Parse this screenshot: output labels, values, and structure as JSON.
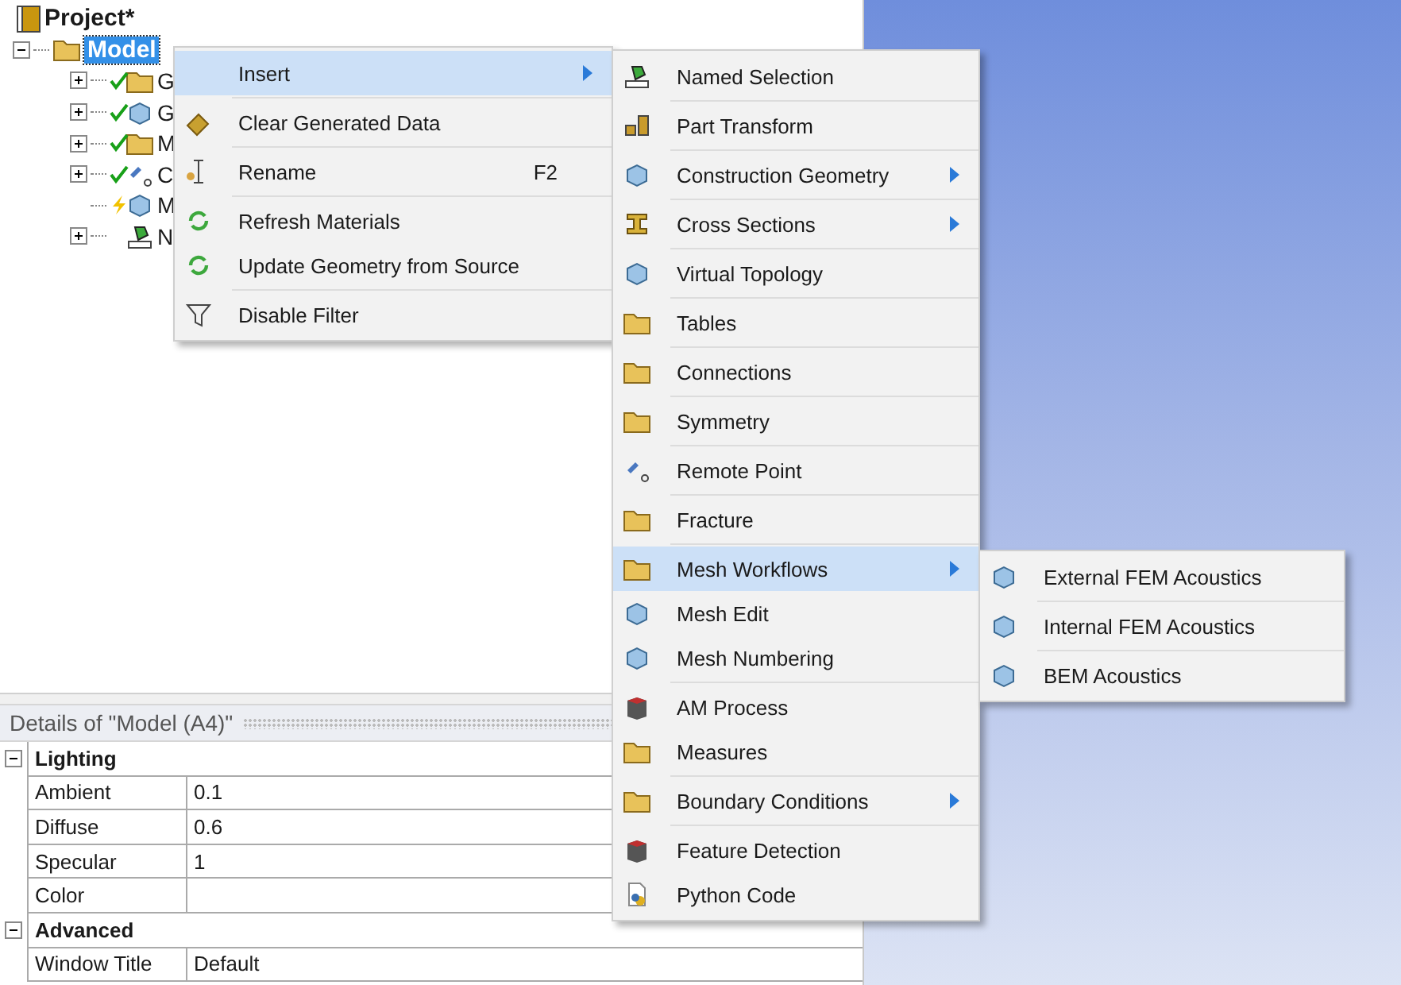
{
  "tree": {
    "root": {
      "label": "Project*"
    },
    "model": {
      "label": "Model",
      "selected": true,
      "expanded": true,
      "children": [
        {
          "label": "G",
          "ok": true,
          "stale": false,
          "expandable": true
        },
        {
          "label": "G",
          "ok": true,
          "stale": false,
          "expandable": true
        },
        {
          "label": "M",
          "ok": true,
          "stale": false,
          "expandable": true
        },
        {
          "label": "C",
          "ok": true,
          "stale": false,
          "expandable": true
        },
        {
          "label": "M",
          "ok": false,
          "stale": true,
          "expandable": false
        },
        {
          "label": "N",
          "ok": false,
          "stale": false,
          "expandable": true
        }
      ]
    }
  },
  "context_menu": {
    "items": [
      {
        "label": "Insert",
        "submenu": true,
        "selected": true,
        "divider_below": true
      },
      {
        "label": "Clear Generated Data",
        "submenu": false,
        "selected": false,
        "divider_below": true
      },
      {
        "label": "Rename",
        "shortcut": "F2",
        "submenu": false,
        "selected": false,
        "divider_below": true
      },
      {
        "label": "Refresh Materials",
        "submenu": false,
        "selected": false,
        "divider_below": false
      },
      {
        "label": "Update Geometry from Source",
        "submenu": false,
        "selected": false,
        "divider_below": true
      },
      {
        "label": "Disable Filter",
        "submenu": false,
        "selected": false,
        "divider_below": false
      }
    ]
  },
  "insert_menu": {
    "items": [
      {
        "label": "Named Selection",
        "submenu": false,
        "selected": false,
        "divider_below": true
      },
      {
        "label": "Part Transform",
        "submenu": false,
        "selected": false,
        "divider_below": true
      },
      {
        "label": "Construction Geometry",
        "submenu": true,
        "selected": false,
        "divider_below": true
      },
      {
        "label": "Cross Sections",
        "submenu": true,
        "selected": false,
        "divider_below": true
      },
      {
        "label": "Virtual Topology",
        "submenu": false,
        "selected": false,
        "divider_below": true
      },
      {
        "label": "Tables",
        "submenu": false,
        "selected": false,
        "divider_below": true
      },
      {
        "label": "Connections",
        "submenu": false,
        "selected": false,
        "divider_below": true
      },
      {
        "label": "Symmetry",
        "submenu": false,
        "selected": false,
        "divider_below": true
      },
      {
        "label": "Remote Point",
        "submenu": false,
        "selected": false,
        "divider_below": true
      },
      {
        "label": "Fracture",
        "submenu": false,
        "selected": false,
        "divider_below": true
      },
      {
        "label": "Mesh Workflows",
        "submenu": true,
        "selected": true,
        "divider_below": false
      },
      {
        "label": "Mesh Edit",
        "submenu": false,
        "selected": false,
        "divider_below": false
      },
      {
        "label": "Mesh Numbering",
        "submenu": false,
        "selected": false,
        "divider_below": true
      },
      {
        "label": "AM Process",
        "submenu": false,
        "selected": false,
        "divider_below": false
      },
      {
        "label": "Measures",
        "submenu": false,
        "selected": false,
        "divider_below": true
      },
      {
        "label": "Boundary Conditions",
        "submenu": true,
        "selected": false,
        "divider_below": true
      },
      {
        "label": "Feature Detection",
        "submenu": false,
        "selected": false,
        "divider_below": false
      },
      {
        "label": "Python Code",
        "submenu": false,
        "selected": false,
        "divider_below": false
      }
    ]
  },
  "mesh_workflows_menu": {
    "items": [
      {
        "label": "External FEM Acoustics",
        "submenu": false,
        "selected": false,
        "divider_below": true
      },
      {
        "label": "Internal FEM Acoustics",
        "submenu": false,
        "selected": false,
        "divider_below": true
      },
      {
        "label": "BEM Acoustics",
        "submenu": false,
        "selected": false,
        "divider_below": false
      }
    ]
  },
  "details": {
    "title": "Details of \"Model (A4)\"",
    "groups": [
      {
        "name": "Lighting",
        "expanded": true,
        "rows": [
          {
            "label": "Ambient",
            "value": "0.1"
          },
          {
            "label": "Diffuse",
            "value": "0.6"
          },
          {
            "label": "Specular",
            "value": "1"
          },
          {
            "label": "Color"
          }
        ]
      },
      {
        "name": "Advanced",
        "expanded": true,
        "rows": [
          {
            "label": "Window Title",
            "value": "Default"
          }
        ]
      }
    ]
  }
}
